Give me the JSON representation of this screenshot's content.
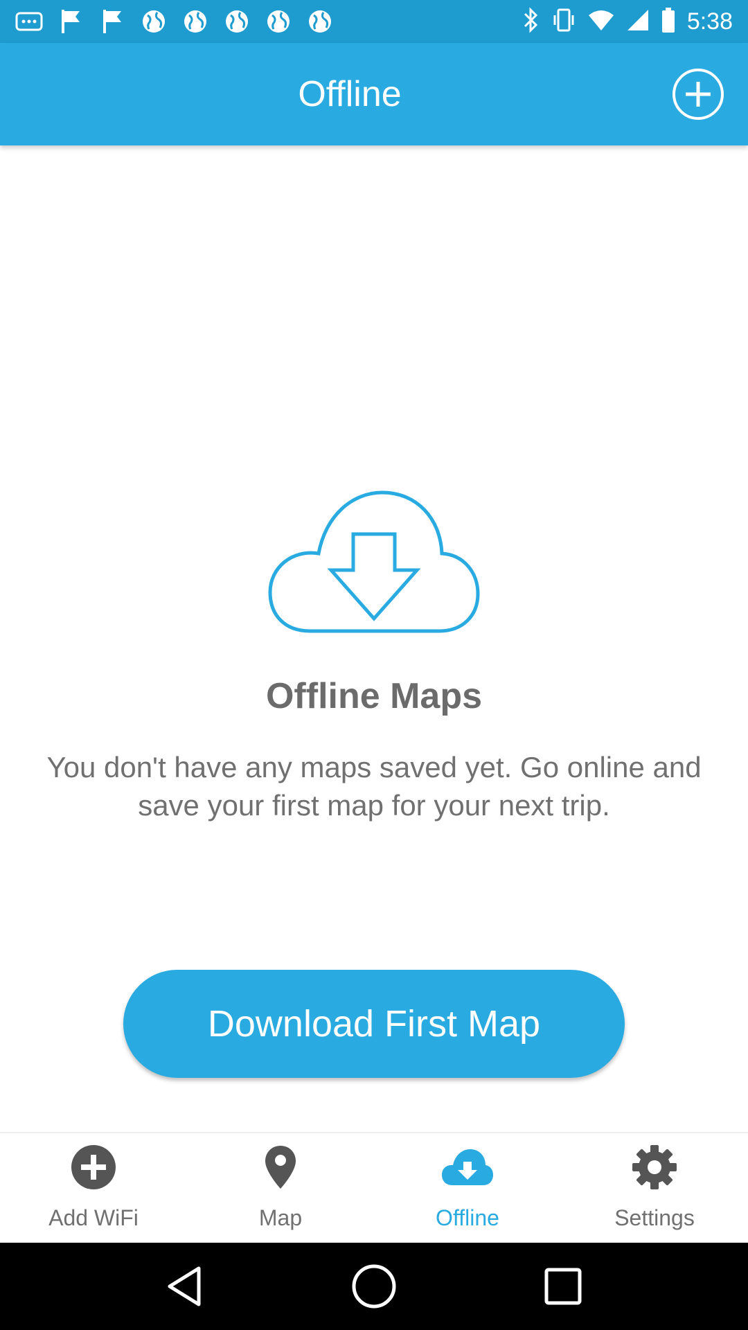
{
  "status_bar": {
    "time": "5:38",
    "left_icons": [
      "more-icon",
      "flag-icon",
      "flag-icon",
      "globe-icon",
      "globe-icon",
      "globe-icon",
      "globe-icon",
      "globe-icon"
    ],
    "right_icons": [
      "bluetooth-icon",
      "vibrate-icon",
      "wifi-icon",
      "signal-icon",
      "battery-icon"
    ]
  },
  "header": {
    "title": "Offline",
    "add_icon": "add-circle-icon"
  },
  "empty_state": {
    "icon": "cloud-download-icon",
    "title": "Offline Maps",
    "description": "You don't have any maps saved yet. Go online and save your first map for your next trip."
  },
  "primary_action": {
    "label": "Download First Map"
  },
  "bottom_nav": {
    "items": [
      {
        "label": "Add WiFi",
        "icon": "add-circle-icon",
        "active": false
      },
      {
        "label": "Map",
        "icon": "location-pin-icon",
        "active": false
      },
      {
        "label": "Offline",
        "icon": "cloud-download-icon",
        "active": true
      },
      {
        "label": "Settings",
        "icon": "gear-icon",
        "active": false
      }
    ]
  },
  "colors": {
    "accent": "#29abe2",
    "status_bar": "#1e9bcf",
    "text_gray": "#707070",
    "icon_dark": "#555555"
  }
}
